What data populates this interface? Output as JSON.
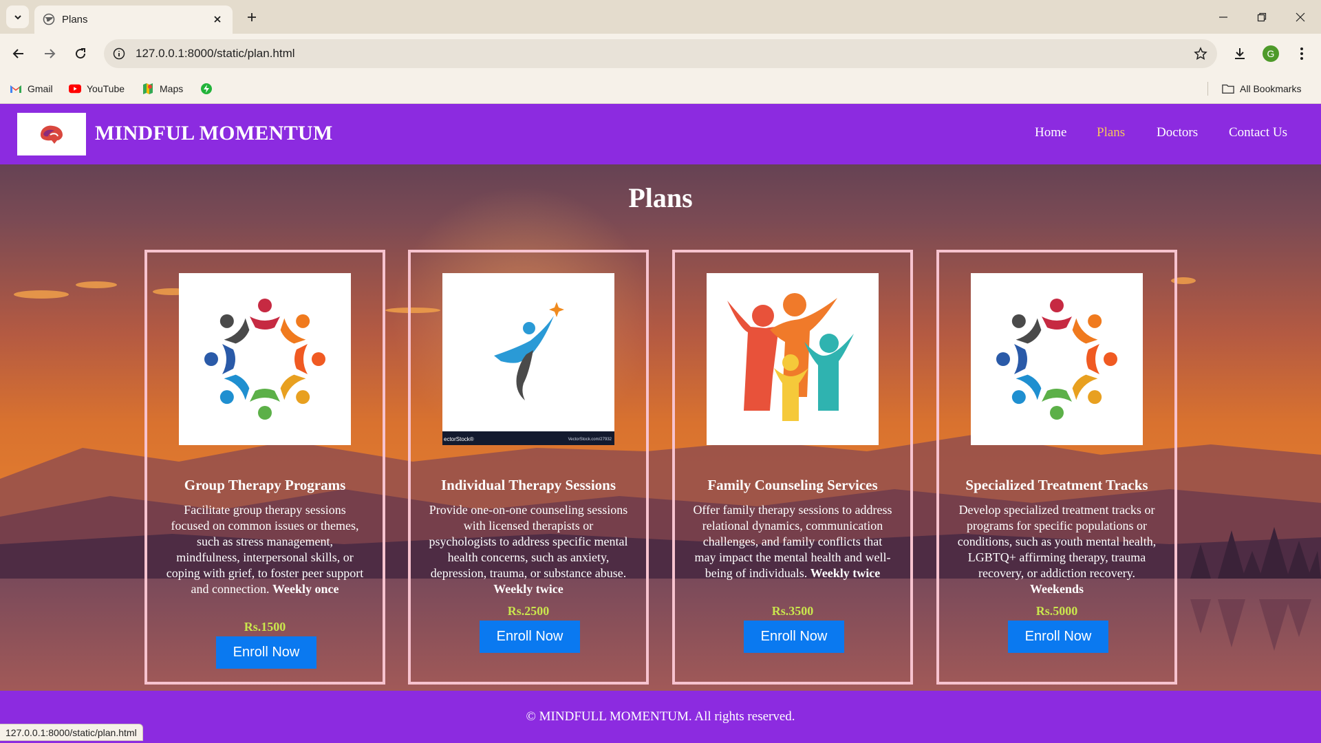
{
  "browser": {
    "tab_title": "Plans",
    "url": "127.0.0.1:8000/static/plan.html",
    "bookmarks": [
      {
        "label": "Gmail",
        "icon": "gmail-icon"
      },
      {
        "label": "YouTube",
        "icon": "youtube-icon"
      },
      {
        "label": "Maps",
        "icon": "maps-icon"
      },
      {
        "label": "",
        "icon": "extension-bolt-icon"
      }
    ],
    "all_bookmarks_label": "All Bookmarks",
    "profile_initial": "G",
    "status_url": "127.0.0.1:8000/static/plan.html"
  },
  "header": {
    "brand": "MINDFUL MOMENTUM",
    "nav": [
      {
        "label": "Home",
        "active": false
      },
      {
        "label": "Plans",
        "active": true
      },
      {
        "label": "Doctors",
        "active": false
      },
      {
        "label": "Contact Us",
        "active": false
      }
    ]
  },
  "page": {
    "title": "Plans"
  },
  "plans": [
    {
      "title": "Group Therapy Programs",
      "description": "Facilitate group therapy sessions focused on common issues or themes, such as stress management, mindfulness, interpersonal skills, or coping with grief, to foster peer support and connection.",
      "frequency": "Weekly once",
      "price": "Rs.1500",
      "button": "Enroll Now",
      "image": "people-circle-logo"
    },
    {
      "title": "Individual Therapy Sessions",
      "description": "Provide one-on-one counseling sessions with licensed therapists or psychologists to address specific mental health concerns, such as anxiety, depression, trauma, or substance abuse.",
      "frequency": "Weekly twice",
      "price": "Rs.2500",
      "button": "Enroll Now",
      "image": "jumping-figure-star-logo",
      "image_caption_left": "ectorStock®",
      "image_caption_right": "VectorStock.com/27932"
    },
    {
      "title": "Family Counseling Services",
      "description": "Offer family therapy sessions to address relational dynamics, communication challenges, and family conflicts that may impact the mental health and well-being of individuals.",
      "frequency": "Weekly twice",
      "price": "Rs.3500",
      "button": "Enroll Now",
      "image": "family-figures-logo"
    },
    {
      "title": "Specialized Treatment Tracks",
      "description": "Develop specialized treatment tracks or programs for specific populations or conditions, such as youth mental health, LGBTQ+ affirming therapy, trauma recovery, or addiction recovery.",
      "frequency": "Weekends",
      "price": "Rs.5000",
      "button": "Enroll Now",
      "image": "people-circle-logo"
    }
  ],
  "footer": {
    "text": "© MINDFULL MOMENTUM. All rights reserved."
  },
  "colors": {
    "header_bg": "#8c2be0",
    "active_nav": "#f6c65b",
    "card_border": "#f7c3cf",
    "price": "#c9e64d",
    "button": "#0a79f0"
  }
}
